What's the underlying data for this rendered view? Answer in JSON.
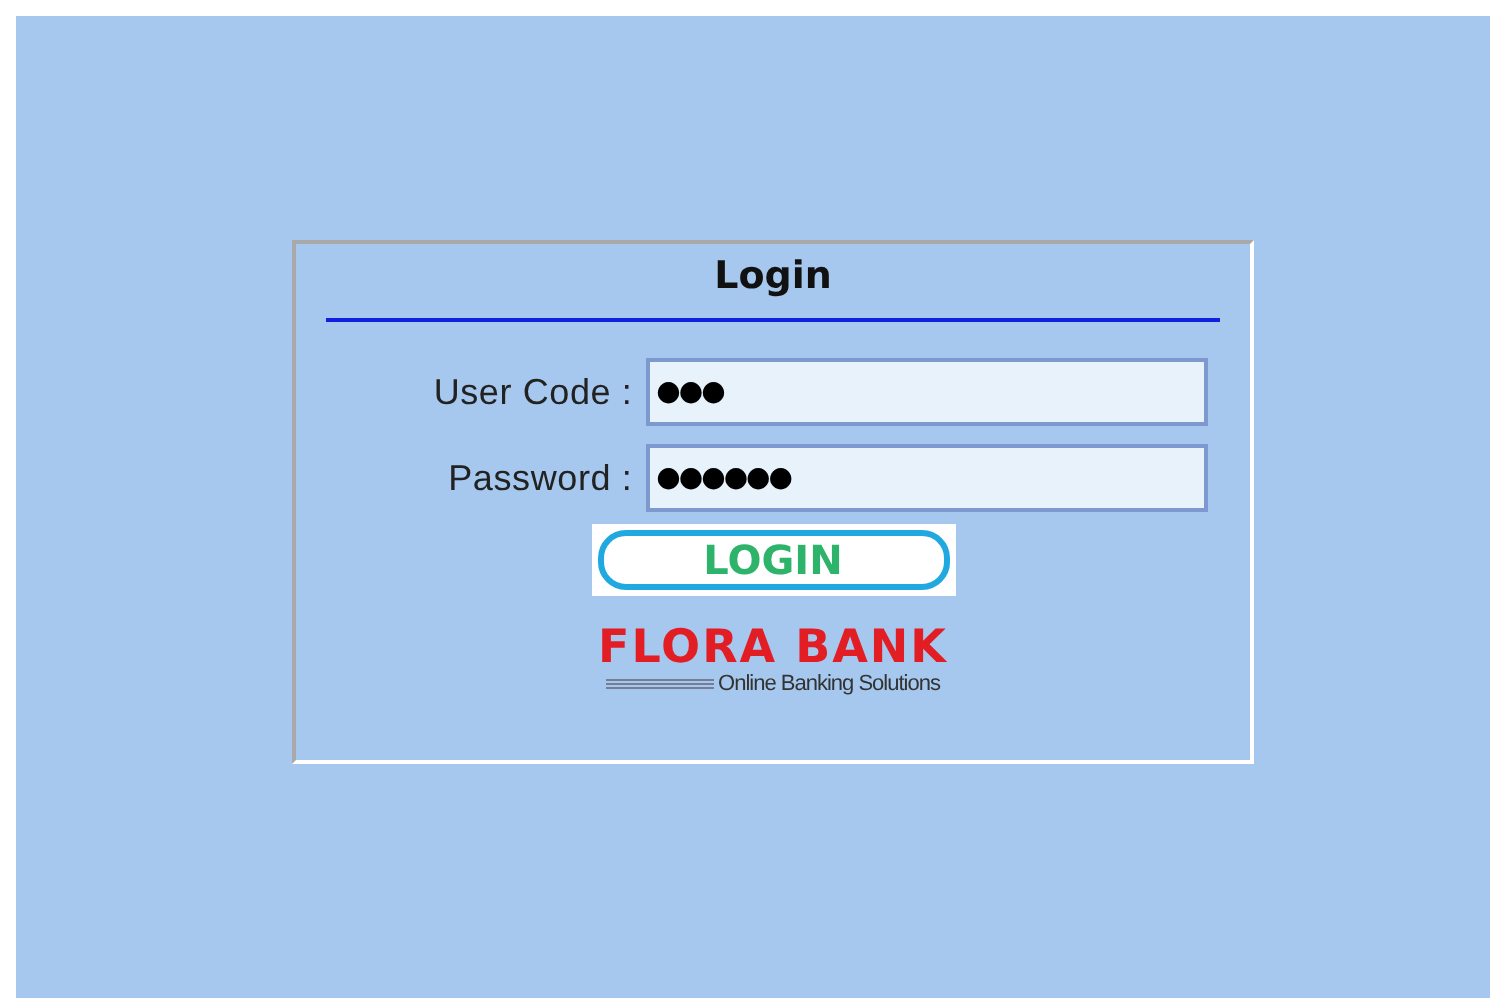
{
  "login_panel": {
    "title": "Login",
    "fields": [
      {
        "label": "User Code :",
        "value": "●●●"
      },
      {
        "label": "Password :",
        "value": "●●●●●●"
      }
    ],
    "button": "LOGIN",
    "logo": {
      "name": "FLORA BANK",
      "tagline": "Online Banking Solutions"
    }
  }
}
